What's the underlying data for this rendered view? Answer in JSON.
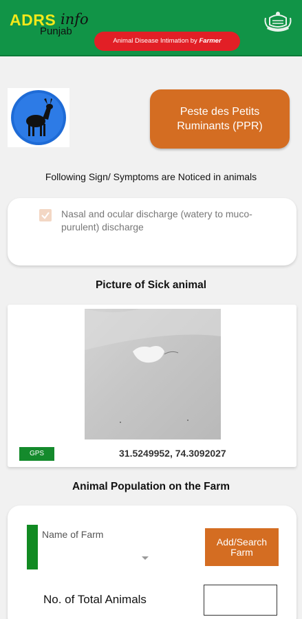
{
  "header": {
    "logo_adrs": "ADRS",
    "logo_info": "info",
    "logo_region": "Punjab",
    "tagline_prefix": "Animal Disease Intimation by ",
    "tagline_emphasis": "Farmer",
    "emblem_icon": "government-emblem-icon",
    "colors": {
      "background": "#119447",
      "logo": "#f3e81a",
      "tagline": "#e21f26"
    }
  },
  "disease": {
    "image_icon": "goat-icon",
    "button_label": "Peste des Petits Ruminants (PPR)",
    "button_color": "#d46d22"
  },
  "symptoms": {
    "heading": "Following Sign/ Symptoms are Noticed in animals",
    "items": [
      {
        "label": "Nasal and ocular discharge (watery to muco-purulent) discharge",
        "checked": true
      }
    ]
  },
  "picture": {
    "heading": "Picture of Sick animal",
    "gps_label": "GPS",
    "coordinates": "31.5249952, 74.3092027"
  },
  "population": {
    "heading": "Animal Population on the Farm",
    "farm_label": "Name of Farm",
    "add_search_button": "Add/Search Farm",
    "total_animals_label": "No. of Total Animals",
    "total_animals_value": ""
  }
}
